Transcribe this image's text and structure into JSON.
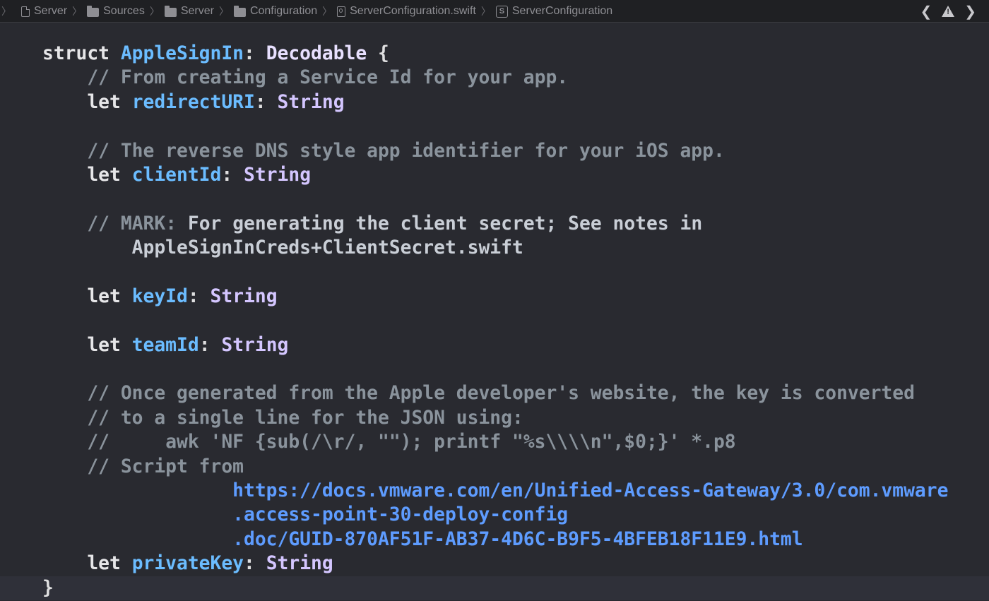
{
  "jumpbar": {
    "lead_glyph": "〉",
    "crumbs": [
      {
        "label": "Server",
        "icon": "file-icon"
      },
      {
        "label": "Sources",
        "icon": "folder-icon"
      },
      {
        "label": "Server",
        "icon": "folder-icon"
      },
      {
        "label": "Configuration",
        "icon": "folder-icon"
      },
      {
        "label": "ServerConfiguration.swift",
        "icon": "swift-file-icon"
      },
      {
        "label": "ServerConfiguration",
        "icon": "struct-icon"
      }
    ],
    "separator": "〉",
    "struct_glyph": "S",
    "nav_back_glyph": "❮",
    "nav_forward_glyph": "❯"
  },
  "code": {
    "line1": {
      "kw": "struct",
      "name": "AppleSignIn",
      "colon": ":",
      "proto": "Decodable",
      "brace": "{"
    },
    "line2": "// From creating a Service Id for your app.",
    "line3": {
      "kw": "let",
      "name": "redirectURI",
      "colon": ":",
      "type": "String"
    },
    "line5": "// The reverse DNS style app identifier for your iOS app.",
    "line6": {
      "kw": "let",
      "name": "clientId",
      "colon": ":",
      "type": "String"
    },
    "line8": {
      "slashes": "//",
      "mark": "MARK:",
      "text": "For generating the client secret; See notes in"
    },
    "line9": "AppleSignInCreds+ClientSecret.swift",
    "line11": {
      "kw": "let",
      "name": "keyId",
      "colon": ":",
      "type": "String"
    },
    "line13": {
      "kw": "let",
      "name": "teamId",
      "colon": ":",
      "type": "String"
    },
    "line15": "// Once generated from the Apple developer's website, the key is converted",
    "line16": "// to a single line for the JSON using:",
    "line17_slashes": "//",
    "line17_cmd": "awk 'NF {sub(/\\r/, \"\"); printf \"%s\\\\\\\\n\",$0;}' *.p8",
    "line18": "// Script from",
    "url_line1": "https://docs.vmware.com/en/Unified-Access-Gateway/3.0/com.vmware",
    "url_line2": ".access-point-30-deploy-config",
    "url_line3": ".doc/GUID-870AF51F-AB37-4D6C-B9F5-4BFEB18F11E9.html",
    "line19": {
      "kw": "let",
      "name": "privateKey",
      "colon": ":",
      "type": "String"
    },
    "line20": "}"
  }
}
